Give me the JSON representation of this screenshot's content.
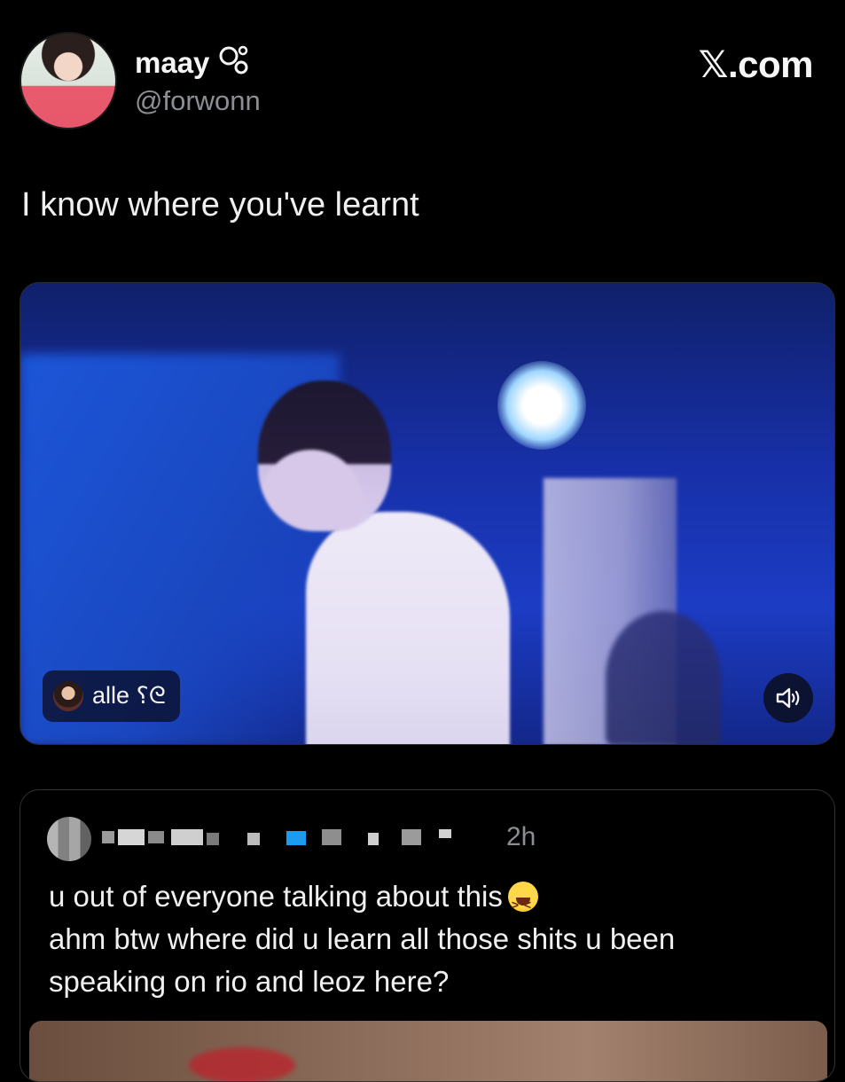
{
  "post": {
    "author": {
      "display_name": "maay",
      "name_decoration": "bubbles-icon",
      "handle": "@forwonn"
    },
    "brand": "𝕏.com",
    "text": "I know where you've learnt",
    "media": {
      "tag_label": "alle ⸮ᘓ",
      "sound_icon": "speaker-icon"
    }
  },
  "reply": {
    "time": "2h",
    "lines": [
      "u out of everyone talking about this",
      "ahm btw where did u learn all those shits u been",
      "speaking on rio and leoz  here?"
    ],
    "emoji": "grinning-squinting-face"
  },
  "colors": {
    "background": "#000000",
    "text_primary": "#f0f0f0",
    "text_secondary": "#8b8f94",
    "border": "#2f3336",
    "media_blue": "#1c3cc4"
  }
}
